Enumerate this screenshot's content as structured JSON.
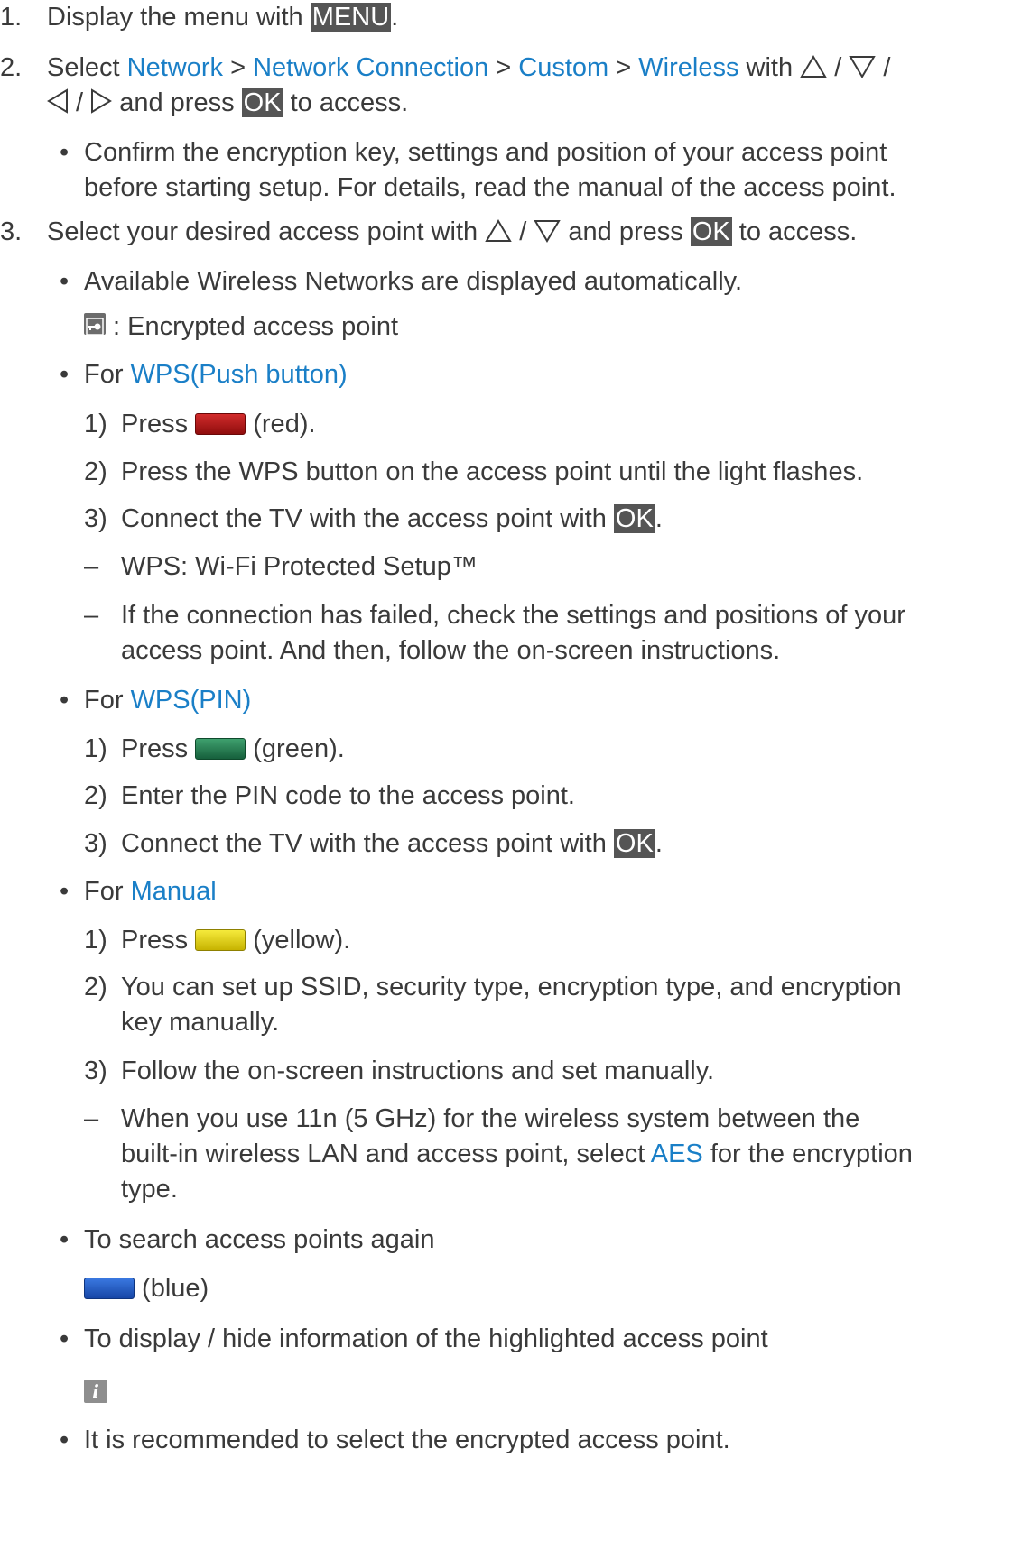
{
  "step1": {
    "num": "1.",
    "pre": "Display the menu with ",
    "key": "MENU",
    "post": "."
  },
  "step2": {
    "num": "2.",
    "pre": "Select ",
    "links": [
      "Network",
      "Network Connection",
      "Custom",
      "Wireless"
    ],
    "sep": " > ",
    "with": " with ",
    "slash": " / ",
    "and_press": " and press ",
    "key": "OK",
    "post": " to access.",
    "note": [
      "Confirm the encryption key, settings and position of your access point",
      "before starting setup. For details, read the manual of the access point."
    ]
  },
  "step3": {
    "num": "3.",
    "pre": "Select your desired access point with ",
    "slash": " / ",
    "mid": " and press ",
    "key": "OK",
    "post": " to access."
  },
  "bullet": "•",
  "dash": "–",
  "available": {
    "text": "Available Wireless Networks are displayed automatically.",
    "lock_text": " : Encrypted access point"
  },
  "wps_push": {
    "pre": "For ",
    "link": "WPS(Push button)",
    "s1": {
      "num": "1)",
      "pre": "Press ",
      "post": " (red)."
    },
    "s2": {
      "num": "2)",
      "text": "Press the WPS button on the access point until the light flashes."
    },
    "s3": {
      "num": "3)",
      "pre": "Connect the TV with the access point with ",
      "key": "OK",
      "post": "."
    },
    "d1": "WPS: Wi-Fi Protected Setup™",
    "d2": [
      "If the connection has failed, check the settings and positions of your",
      "access point. And then, follow the on-screen instructions."
    ]
  },
  "wps_pin": {
    "pre": "For ",
    "link": "WPS(PIN)",
    "s1": {
      "num": "1)",
      "pre": "Press ",
      "post": " (green)."
    },
    "s2": {
      "num": "2)",
      "text": "Enter the PIN code to the access point."
    },
    "s3": {
      "num": "3)",
      "pre": "Connect the TV with the access point with ",
      "key": "OK",
      "post": "."
    }
  },
  "manual": {
    "pre": "For ",
    "link": "Manual",
    "s1": {
      "num": "1)",
      "pre": "Press ",
      "post": " (yellow)."
    },
    "s2": {
      "num": "2)",
      "lines": [
        "You can set up SSID, security type, encryption type, and encryption",
        "key manually."
      ]
    },
    "s3": {
      "num": "3)",
      "text": "Follow the on-screen instructions and set manually."
    },
    "d1": {
      "l1": "When you use 11n (5 GHz) for the wireless system between the",
      "l2_pre": "built-in wireless LAN and access point, select ",
      "l2_link": "AES",
      "l2_post": " for the encryption",
      "l3": "type."
    }
  },
  "search": {
    "text": "To search access points again",
    "blue_label": " (blue)"
  },
  "info": {
    "text": "To display / hide information of the highlighted access point",
    "icon": "i"
  },
  "recommend": {
    "text": "It is recommended to select the encrypted access point."
  },
  "colors": {
    "link": "#1a7fc7",
    "key_bg": "#555555",
    "text": "#3a3a3a"
  }
}
